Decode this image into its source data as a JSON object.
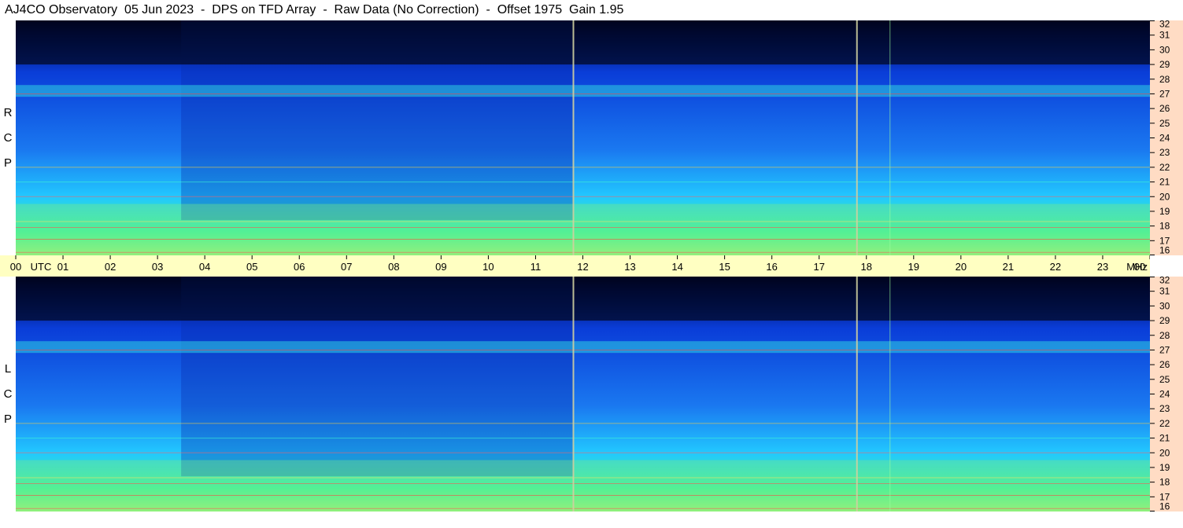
{
  "title": "AJ4CO Observatory  05 Jun 2023  -  DPS on TFD Array  -  Raw Data (No Correction)  -  Offset 1975  Gain 1.95",
  "polarization_labels": {
    "top": "R\n\nC\n\nP",
    "bottom": "L\n\nC\n\nP"
  },
  "chart_data": [
    {
      "type": "heatmap",
      "name": "RCP",
      "x": [
        "00",
        "01",
        "02",
        "03",
        "04",
        "05",
        "06",
        "07",
        "08",
        "09",
        "10",
        "11",
        "12",
        "13",
        "14",
        "15",
        "16",
        "17",
        "18",
        "19",
        "20",
        "21",
        "22",
        "23",
        "00"
      ],
      "x_unit": "UTC",
      "y_ticks": [
        32,
        31,
        30,
        29,
        28,
        27,
        26,
        25,
        24,
        23,
        22,
        21,
        20,
        19,
        18,
        17,
        16
      ],
      "y_unit": "MHz",
      "xlim": [
        0,
        24
      ],
      "ylim": [
        16,
        32
      ],
      "colormap": "jet",
      "vertical_artifacts_utc": [
        11.8,
        17.8,
        18.5
      ]
    },
    {
      "type": "heatmap",
      "name": "LCP",
      "x": [
        "00",
        "01",
        "02",
        "03",
        "04",
        "05",
        "06",
        "07",
        "08",
        "09",
        "10",
        "11",
        "12",
        "13",
        "14",
        "15",
        "16",
        "17",
        "18",
        "19",
        "20",
        "21",
        "22",
        "23",
        "00"
      ],
      "x_unit": "UTC",
      "y_ticks": [
        32,
        31,
        30,
        29,
        28,
        27,
        26,
        25,
        24,
        23,
        22,
        21,
        20,
        19,
        18,
        17,
        16
      ],
      "y_unit": "MHz",
      "xlim": [
        0,
        24
      ],
      "ylim": [
        16,
        32
      ],
      "colormap": "jet",
      "vertical_artifacts_utc": [
        11.8,
        17.8,
        18.5
      ]
    }
  ],
  "colors": {
    "axis_utc_bg": "#ffffc2",
    "axis_freq_bg": "#ffdcc4",
    "spectrogram_dark": "#000022",
    "spectrogram_blue": "#0a3dd8",
    "spectrogram_cyan": "#22c8ff",
    "spectrogram_green": "#3cf0a0"
  }
}
